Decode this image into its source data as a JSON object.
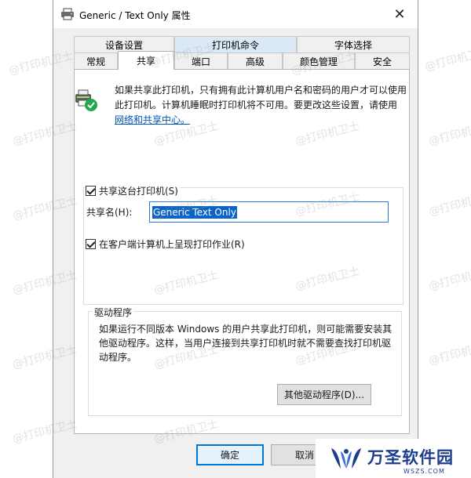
{
  "window": {
    "title": "Generic / Text Only 属性",
    "close_glyph": "✕"
  },
  "tabs_row1": [
    {
      "label": "设备设置"
    },
    {
      "label": "打印机命令"
    },
    {
      "label": "字体选择"
    }
  ],
  "tabs_row2": [
    {
      "label": "常规"
    },
    {
      "label": "共享"
    },
    {
      "label": "端口"
    },
    {
      "label": "高级"
    },
    {
      "label": "颜色管理"
    },
    {
      "label": "安全"
    }
  ],
  "active_tab": "共享",
  "info": {
    "text": "如果共享此打印机，只有拥有此计算机用户名和密码的用户才可以使用此打印机。计算机睡眠时打印机将不可用。要更改这些设置，请使用",
    "link": "网络和共享中心。"
  },
  "share": {
    "checkbox_label": "共享这台打印机(S)",
    "checked": true,
    "name_label": "共享名(H):",
    "name_value": "Generic  Text Only",
    "render_label": "在客户端计算机上呈现打印作业(R)",
    "render_checked": true
  },
  "drivers": {
    "legend": "驱动程序",
    "text": "如果运行不同版本 Windows 的用户共享此打印机，则可能需要安装其他驱动程序。这样，当用户连接到共享打印机时就不需要查找打印机驱动程序。",
    "button": "其他驱动程序(D)..."
  },
  "buttons": {
    "ok": "确定",
    "cancel": "取消"
  },
  "watermark": "@打印机卫士",
  "logo": {
    "main": "万圣软件园",
    "sub": "WSZS.COM",
    "color": "#1d3d8f"
  },
  "icons": {
    "title": "printer-icon",
    "info": "shared-printer-icon"
  },
  "colors": {
    "accent": "#0078d7",
    "link": "#0055b3",
    "tab_highlight": "#dbe9f7"
  }
}
